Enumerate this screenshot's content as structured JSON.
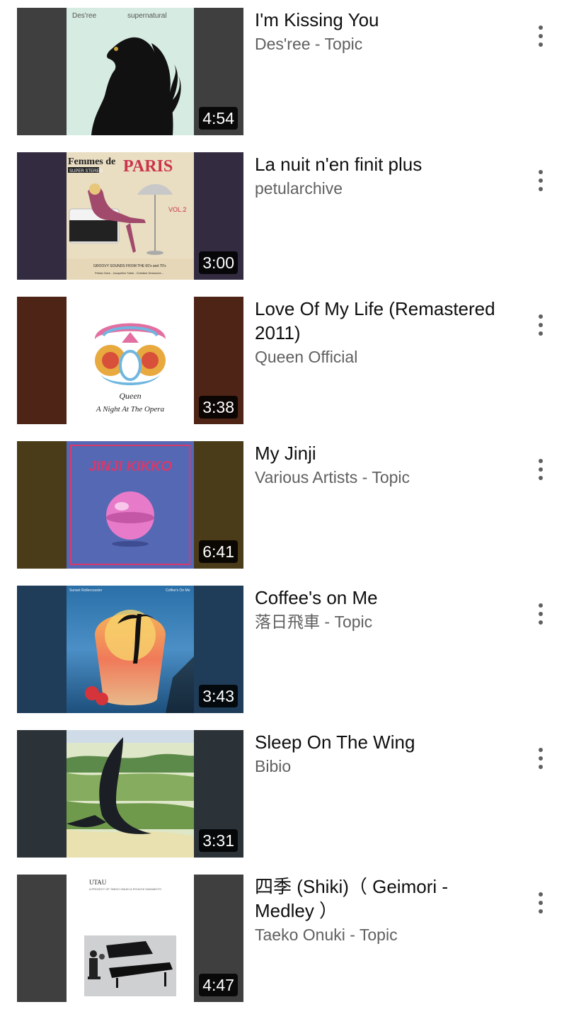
{
  "videos": [
    {
      "title": "I'm Kissing You",
      "channel": "Des'ree - Topic",
      "duration": "4:54",
      "thumb_bg": "#3f3f3f",
      "art_left_text": "Des'ree",
      "art_right_text": "supernatural",
      "art_icon": "album-cover-desree-supernatural"
    },
    {
      "title": "La nuit n'en finit plus",
      "channel": "petularchive",
      "duration": "3:00",
      "thumb_bg": "#332b40",
      "art_top_left": "Femmes de",
      "art_top_right": "PARIS",
      "art_badge": "SUPER STEREO",
      "art_vol": "VOL.2",
      "art_caption": "GROOVY SOUNDS FROM THE 60's and 70's",
      "art_names": "Petula Clark  -  Jacqueline  Taieb  -  Christine Delaroche...",
      "art_icon": "album-cover-femmes-de-paris"
    },
    {
      "title": "Love Of My Life (Remastered 2011)",
      "channel": "Queen Official",
      "duration": "3:38",
      "thumb_bg": "#4e2416",
      "art_line1": "Queen",
      "art_line2": "A Night At The Opera",
      "art_icon": "album-cover-queen-night-at-the-opera"
    },
    {
      "title": "My Jinji",
      "channel": "Various Artists - Topic",
      "duration": "6:41",
      "thumb_bg": "#4a3b19",
      "art_title": "JINJI KIKKO",
      "art_icon": "album-cover-jinji-kikko"
    },
    {
      "title": "Coffee's on Me",
      "channel": "落日飛車 - Topic",
      "duration": "3:43",
      "thumb_bg": "#1f3c59",
      "art_left_text": "Sunset Rollercoaster",
      "art_right_text": "Coffee's On Me",
      "art_icon": "album-cover-coffees-on-me"
    },
    {
      "title": "Sleep On The Wing",
      "channel": "Bibio",
      "duration": "3:31",
      "thumb_bg": "#2c3338",
      "art_icon": "album-cover-sleep-on-the-wing"
    },
    {
      "title": "四季 (Shiki)（ Geimori - Medley ）",
      "channel": "Taeko Onuki - Topic",
      "duration": "4:47",
      "thumb_bg": "#3f3f3f",
      "art_title": "UTAU",
      "art_subtitle": "A PROJECT OF TAEKO ONUKI & RYUICHI SAKAMOTO",
      "art_icon": "album-cover-utau"
    }
  ],
  "more_icon": "more-vertical-icon",
  "colors": {
    "title": "#0f0f0f",
    "channel": "#606060",
    "duration_bg": "#000000",
    "duration_text": "#ffffff"
  }
}
